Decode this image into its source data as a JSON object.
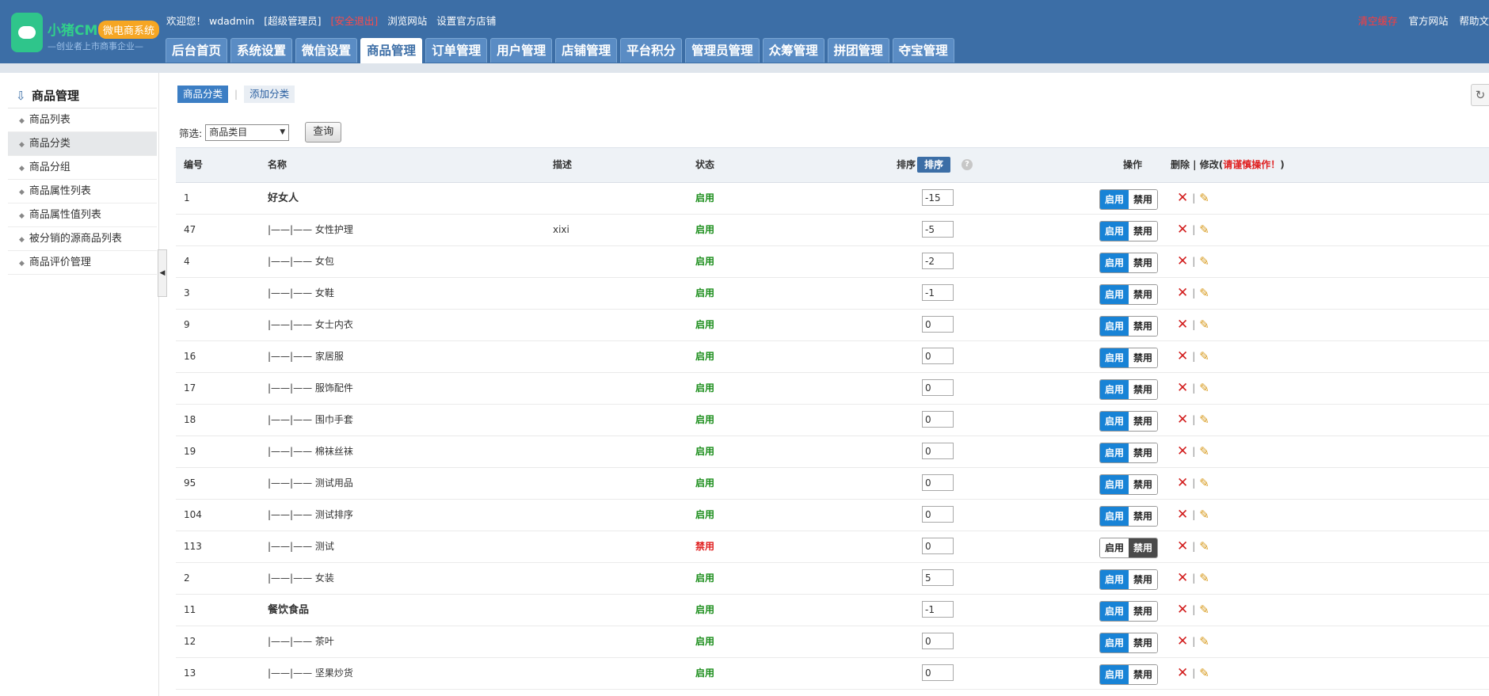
{
  "header": {
    "logo_brand": "小猪CMS",
    "logo_pill": "微电商系统",
    "logo_slogan": "—创业者上市商事企业—",
    "welcome": "欢迎您！ wdadmin",
    "role": "[超级管理员]",
    "logout": "[安全退出]",
    "browse_site": "浏览网站",
    "set_store": "设置官方店铺",
    "clear_cache": "清空缓存",
    "official_site": "官方网站",
    "help": "帮助文"
  },
  "nav": {
    "tabs": [
      "后台首页",
      "系统设置",
      "微信设置",
      "商品管理",
      "订单管理",
      "用户管理",
      "店铺管理",
      "平台积分",
      "管理员管理",
      "众筹管理",
      "拼团管理",
      "夺宝管理"
    ],
    "active_index": 3
  },
  "sidebar": {
    "title": "商品管理",
    "items": [
      "商品列表",
      "商品分类",
      "商品分组",
      "商品属性列表",
      "商品属性值列表",
      "被分销的源商品列表",
      "商品评价管理"
    ],
    "active_index": 1
  },
  "content": {
    "subtab_active": "商品分类",
    "subtab_add": "添加分类",
    "filter_label": "筛选:",
    "filter_value": "商品类目",
    "query_btn": "查询"
  },
  "table": {
    "headers": {
      "id": "编号",
      "name": "名称",
      "desc": "描述",
      "status": "状态",
      "sort": "排序",
      "sort_btn": "排序",
      "ops": "操作",
      "del_edit": "删除 | 修改(",
      "warn": "请谨慎操作！",
      "close": ")"
    },
    "enable_label": "启用",
    "disable_label": "禁用",
    "rows": [
      {
        "id": "1",
        "name": "好女人",
        "bold": true,
        "desc": "",
        "status": "启用",
        "enabled": true,
        "sort": "-15"
      },
      {
        "id": "47",
        "name": "|——|—— 女性护理",
        "bold": false,
        "desc": "xixi",
        "status": "启用",
        "enabled": true,
        "sort": "-5"
      },
      {
        "id": "4",
        "name": "|——|—— 女包",
        "bold": false,
        "desc": "",
        "status": "启用",
        "enabled": true,
        "sort": "-2"
      },
      {
        "id": "3",
        "name": "|——|—— 女鞋",
        "bold": false,
        "desc": "",
        "status": "启用",
        "enabled": true,
        "sort": "-1"
      },
      {
        "id": "9",
        "name": "|——|—— 女士内衣",
        "bold": false,
        "desc": "",
        "status": "启用",
        "enabled": true,
        "sort": "0"
      },
      {
        "id": "16",
        "name": "|——|—— 家居服",
        "bold": false,
        "desc": "",
        "status": "启用",
        "enabled": true,
        "sort": "0"
      },
      {
        "id": "17",
        "name": "|——|—— 服饰配件",
        "bold": false,
        "desc": "",
        "status": "启用",
        "enabled": true,
        "sort": "0"
      },
      {
        "id": "18",
        "name": "|——|—— 围巾手套",
        "bold": false,
        "desc": "",
        "status": "启用",
        "enabled": true,
        "sort": "0"
      },
      {
        "id": "19",
        "name": "|——|—— 棉袜丝袜",
        "bold": false,
        "desc": "",
        "status": "启用",
        "enabled": true,
        "sort": "0"
      },
      {
        "id": "95",
        "name": "|——|—— 测试用品",
        "bold": false,
        "desc": "",
        "status": "启用",
        "enabled": true,
        "sort": "0"
      },
      {
        "id": "104",
        "name": "|——|—— 测试排序",
        "bold": false,
        "desc": "",
        "status": "启用",
        "enabled": true,
        "sort": "0"
      },
      {
        "id": "113",
        "name": "|——|—— 测试",
        "bold": false,
        "desc": "",
        "status": "禁用",
        "enabled": false,
        "sort": "0"
      },
      {
        "id": "2",
        "name": "|——|—— 女装",
        "bold": false,
        "desc": "",
        "status": "启用",
        "enabled": true,
        "sort": "5"
      },
      {
        "id": "11",
        "name": "餐饮食品",
        "bold": true,
        "desc": "",
        "status": "启用",
        "enabled": true,
        "sort": "-1"
      },
      {
        "id": "12",
        "name": "|——|—— 茶叶",
        "bold": false,
        "desc": "",
        "status": "启用",
        "enabled": true,
        "sort": "0"
      },
      {
        "id": "13",
        "name": "|——|—— 坚果炒货",
        "bold": false,
        "desc": "",
        "status": "启用",
        "enabled": true,
        "sort": "0"
      }
    ]
  },
  "colors": {
    "header_bg": "#3c6ea6",
    "enabled_green": "#1a8d1a",
    "disabled_red": "#e02020",
    "button_blue": "#1883d6"
  }
}
